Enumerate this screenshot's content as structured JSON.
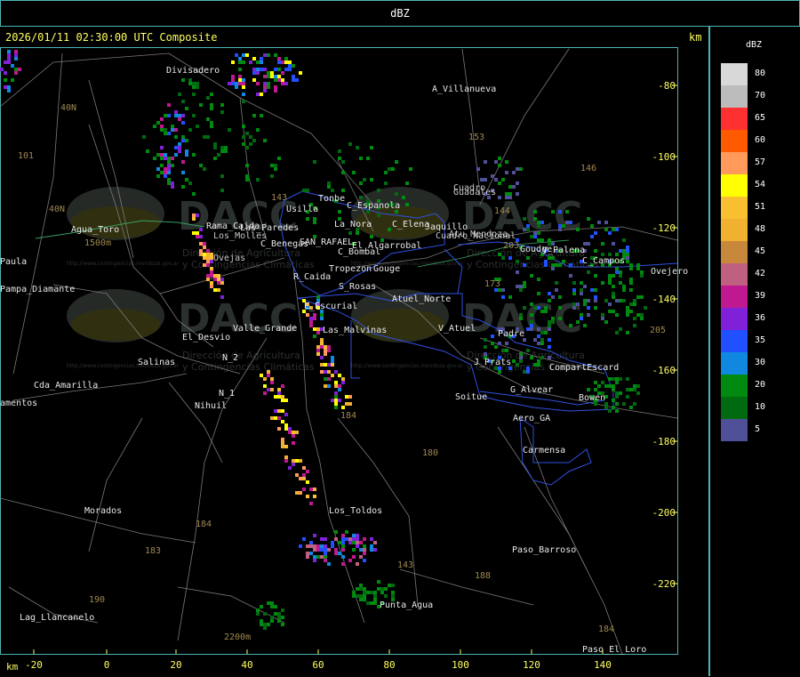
{
  "title": "dBZ",
  "header": "2026/01/11 02:30:00 UTC Composite",
  "axis_unit": "km",
  "legend": {
    "title": "dBZ",
    "entries": [
      {
        "value": "80",
        "color": "#d8d8d8"
      },
      {
        "value": "70",
        "color": "#bcbcbc"
      },
      {
        "value": "65",
        "color": "#ff3030"
      },
      {
        "value": "60",
        "color": "#ff5a00"
      },
      {
        "value": "57",
        "color": "#ff9a5a"
      },
      {
        "value": "54",
        "color": "#ffff00"
      },
      {
        "value": "51",
        "color": "#f8c030"
      },
      {
        "value": "48",
        "color": "#f0b030"
      },
      {
        "value": "45",
        "color": "#c8883c"
      },
      {
        "value": "42",
        "color": "#c06080"
      },
      {
        "value": "39",
        "color": "#c01890"
      },
      {
        "value": "36",
        "color": "#8020d8"
      },
      {
        "value": "35",
        "color": "#2050ff"
      },
      {
        "value": "30",
        "color": "#1088e0"
      },
      {
        "value": "20",
        "color": "#008a10"
      },
      {
        "value": "10",
        "color": "#006a10"
      },
      {
        "value": "5",
        "color": "#505098"
      }
    ]
  },
  "x_ticks": [
    "-20",
    "0",
    "20",
    "40",
    "60",
    "80",
    "100",
    "120",
    "140"
  ],
  "y_ticks": [
    "-80",
    "-100",
    "-120",
    "-140",
    "-160",
    "-180",
    "-200",
    "-220"
  ],
  "places": [
    "Divisadero",
    "A_Villanueva",
    "Agua_Toro",
    "Pampa_Diamante",
    "Paula",
    "El_Desvio",
    "Salinas",
    "Cda_Amarilla",
    "amentos",
    "Nihuil",
    "N_1",
    "N_2",
    "Morados",
    "Lag_Llancanelo",
    "Los_Toldos",
    "Punta_Agua",
    "Paso_Barroso",
    "Paso_El_Loro",
    "Carmensa",
    "Aero_GA",
    "Soitue",
    "G_Alvear",
    "Bowen",
    "CompartEscard",
    "J_Prats",
    "V_Atuel",
    "Padre",
    "Atuel_Norte",
    "E_Escurial",
    "Las_Malvinas",
    "Valle_Grande",
    "R_Caida",
    "S_Rosas",
    "Tropezon",
    "Gouge",
    "C_Bombal",
    "C_Benegas",
    "SAN_RAFAEL",
    "El_Algarrobal",
    "La_Nora",
    "C_Espanola",
    "C_Elena",
    "Jaquillo",
    "Usilla",
    "Tonbe",
    "Rama_Caida",
    "Las_Paredes",
    "Cuadro",
    "C_Campos",
    "Ovejero",
    "Goudge",
    "V_Palena",
    "Ovejas",
    "Guadales",
    "Cuadro_Nacional",
    "Los_Molles",
    "Atu_Mendoza"
  ],
  "route_numbers": [
    "101",
    "40N",
    "40N",
    "143",
    "153",
    "146",
    "144",
    "203",
    "173",
    "184",
    "180",
    "184",
    "183",
    "190",
    "188",
    "143",
    "184",
    "205"
  ],
  "elevation_labels": [
    "1500m",
    "2200m"
  ],
  "watermark": {
    "brand": "DACC",
    "line1": "Dirección de Agricultura",
    "line2": "y Contingencias Climáticas",
    "url": "http://www.contingencias.mendoza.gov.ar"
  }
}
